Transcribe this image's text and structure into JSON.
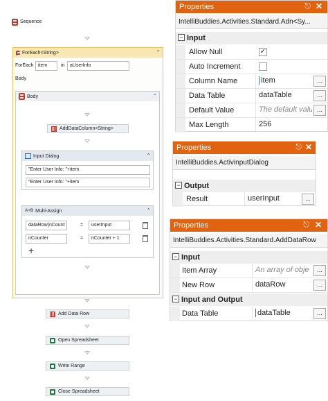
{
  "workflow": {
    "sequence_label": "Sequence",
    "foreach": {
      "title": "ForEach<String>",
      "foreach_label": "ForEach",
      "item_value": "item",
      "in_label": "in",
      "collection_value": "aUserInfo",
      "body_label": "Body"
    },
    "body": {
      "title": "Body",
      "add_data_column": "AddDataColumn<String>",
      "input_dialog": {
        "title": "Input Dialog",
        "field1": "\"Enter User Info: \"+item",
        "field2": "\"Enter User Info: \"+item"
      },
      "multi_assign": {
        "title": "Multi-Assign",
        "rows": [
          {
            "left": "dataRow(nCount",
            "op": "=",
            "right": "userInput"
          },
          {
            "left": "nCounter",
            "op": "=",
            "right": "nCounter + 1"
          }
        ]
      }
    },
    "after": [
      {
        "label": "Add Data Row",
        "icon": "table-icon"
      },
      {
        "label": "Open Spreadsheet",
        "icon": "spreadsheet-icon"
      },
      {
        "label": "Write Range",
        "icon": "spreadsheet-icon"
      },
      {
        "label": "Close Spreadsheet",
        "icon": "spreadsheet-icon"
      }
    ]
  },
  "panel1": {
    "title": "Properties",
    "type_name": "IntelliBuddies.Activities.Standard.Adn<Sy...",
    "category": "Input",
    "rows": [
      {
        "name": "Allow Null",
        "kind": "checkbox",
        "checked": true,
        "value": "✓"
      },
      {
        "name": "Auto Increment",
        "kind": "checkbox",
        "checked": false,
        "value": ""
      },
      {
        "name": "Column Name",
        "kind": "text",
        "value": "item"
      },
      {
        "name": "Data Table",
        "kind": "text",
        "value": "dataTable"
      },
      {
        "name": "Default Value",
        "kind": "placeholder",
        "value": "The default valu"
      },
      {
        "name": "Max Length",
        "kind": "text",
        "value": "256"
      }
    ]
  },
  "panel2": {
    "title": "Properties",
    "type_name": "IntelliBuddies.ActivinputDialog",
    "category": "Output",
    "rows": [
      {
        "name": "Result",
        "kind": "text",
        "value": "userInput"
      }
    ]
  },
  "panel3": {
    "title": "Properties",
    "type_name": "IntelliBuddies.Activities.Standard.AddDataRow",
    "categories": [
      {
        "name": "Input",
        "rows": [
          {
            "name": "Item Array",
            "kind": "placeholder",
            "value": "An array of obje"
          },
          {
            "name": "New Row",
            "kind": "text",
            "value": "dataRow"
          }
        ]
      },
      {
        "name": "Input and Output",
        "rows": [
          {
            "name": "Data Table",
            "kind": "text",
            "value": "dataTable"
          }
        ]
      }
    ]
  },
  "icons": {
    "pin": "pin-icon",
    "close": "close-icon",
    "ellipsis": "ellipsis-button",
    "collapse": "collapse-icon"
  },
  "colors": {
    "panel_title": "#e1620f",
    "foreach_border": "#f0c45a",
    "foreach_header": "#f7e7b5",
    "spreadsheet_icon": "#1e7b3f",
    "table_icon": "#c0392b"
  }
}
